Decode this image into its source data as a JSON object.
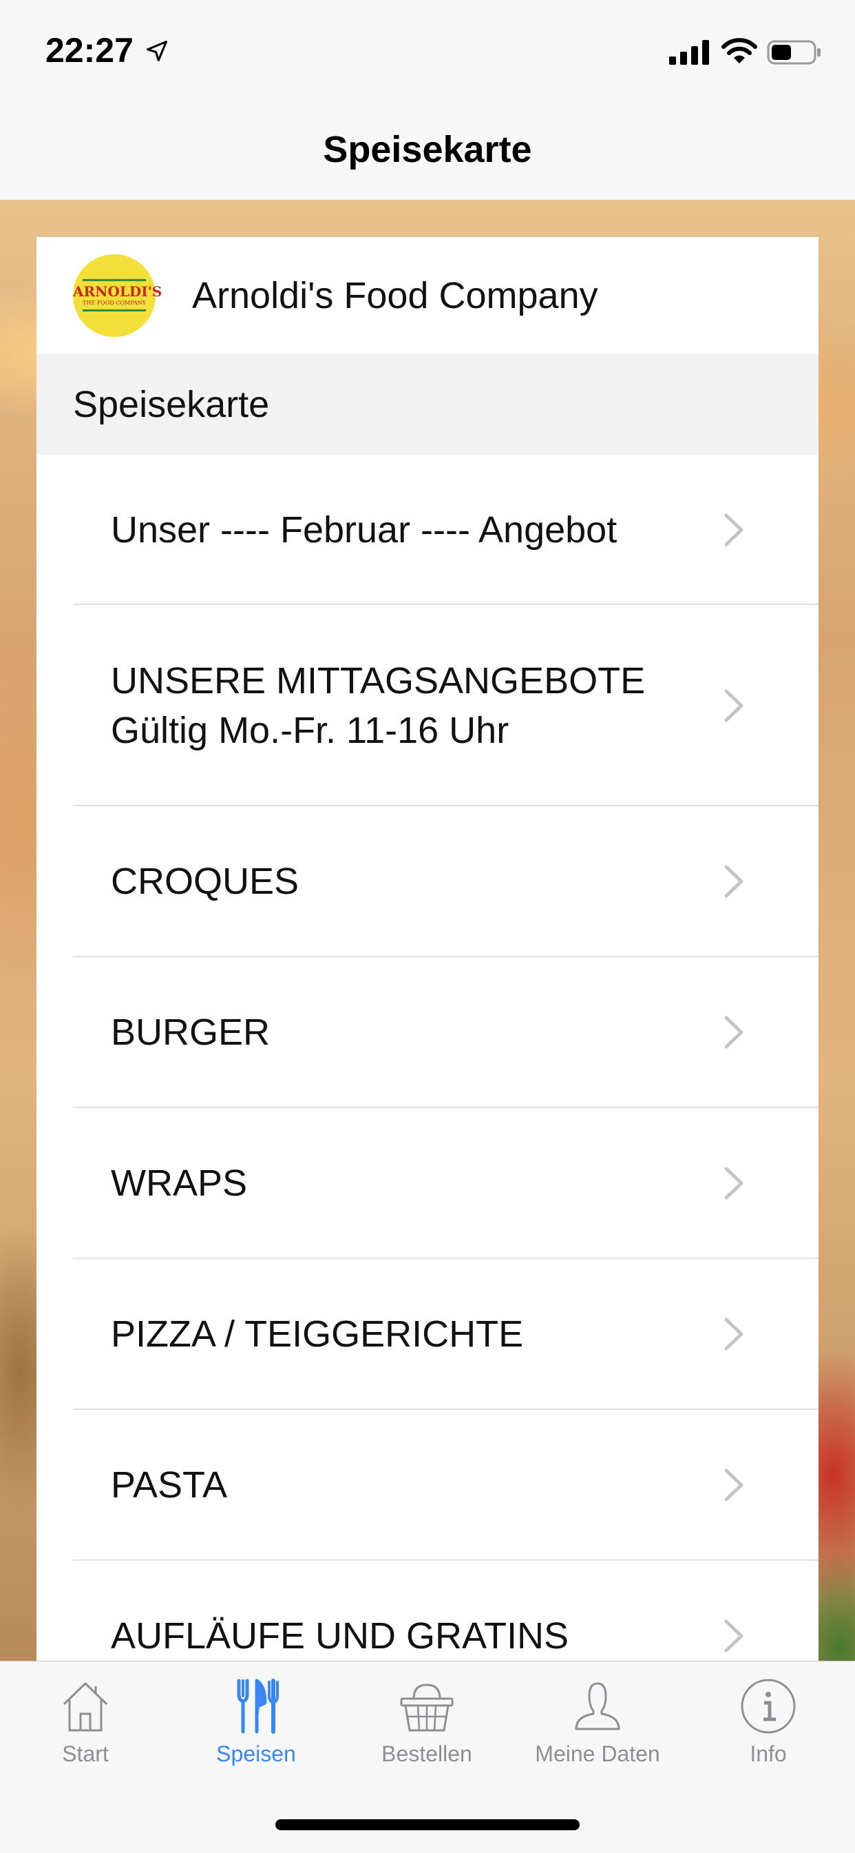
{
  "status_bar": {
    "time": "22:27",
    "icons": [
      "location-arrow-icon",
      "signal-icon",
      "wifi-icon",
      "battery-icon"
    ]
  },
  "nav": {
    "title": "Speisekarte"
  },
  "restaurant": {
    "name": "Arnoldi's Food Company",
    "logo_text": "ARNOLDI'S",
    "logo_subtext": "THE FOOD COMPANY"
  },
  "section": {
    "title": "Speisekarte"
  },
  "menu_items": [
    {
      "line1": "Unser ---- Februar ---- Angebot",
      "line2": ""
    },
    {
      "line1": "UNSERE MITTAGSANGEBOTE",
      "line2": "Gültig Mo.-Fr. 11-16 Uhr"
    },
    {
      "line1": "CROQUES",
      "line2": ""
    },
    {
      "line1": "BURGER",
      "line2": ""
    },
    {
      "line1": "WRAPS",
      "line2": ""
    },
    {
      "line1": "PIZZA / TEIGGERICHTE",
      "line2": ""
    },
    {
      "line1": "PASTA",
      "line2": ""
    },
    {
      "line1": "AUFLÄUFE UND GRATINS",
      "line2": ""
    }
  ],
  "tabs": [
    {
      "label": "Start",
      "icon": "home-icon",
      "active": false
    },
    {
      "label": "Speisen",
      "icon": "fork-knife-icon",
      "active": true
    },
    {
      "label": "Bestellen",
      "icon": "basket-icon",
      "active": false
    },
    {
      "label": "Meine Daten",
      "icon": "person-icon",
      "active": false
    },
    {
      "label": "Info",
      "icon": "info-icon",
      "active": false
    }
  ],
  "colors": {
    "accent": "#3b86f0",
    "inactive": "#8e8e93",
    "logo_yellow": "#f2df3a",
    "logo_red": "#c62a1e"
  }
}
